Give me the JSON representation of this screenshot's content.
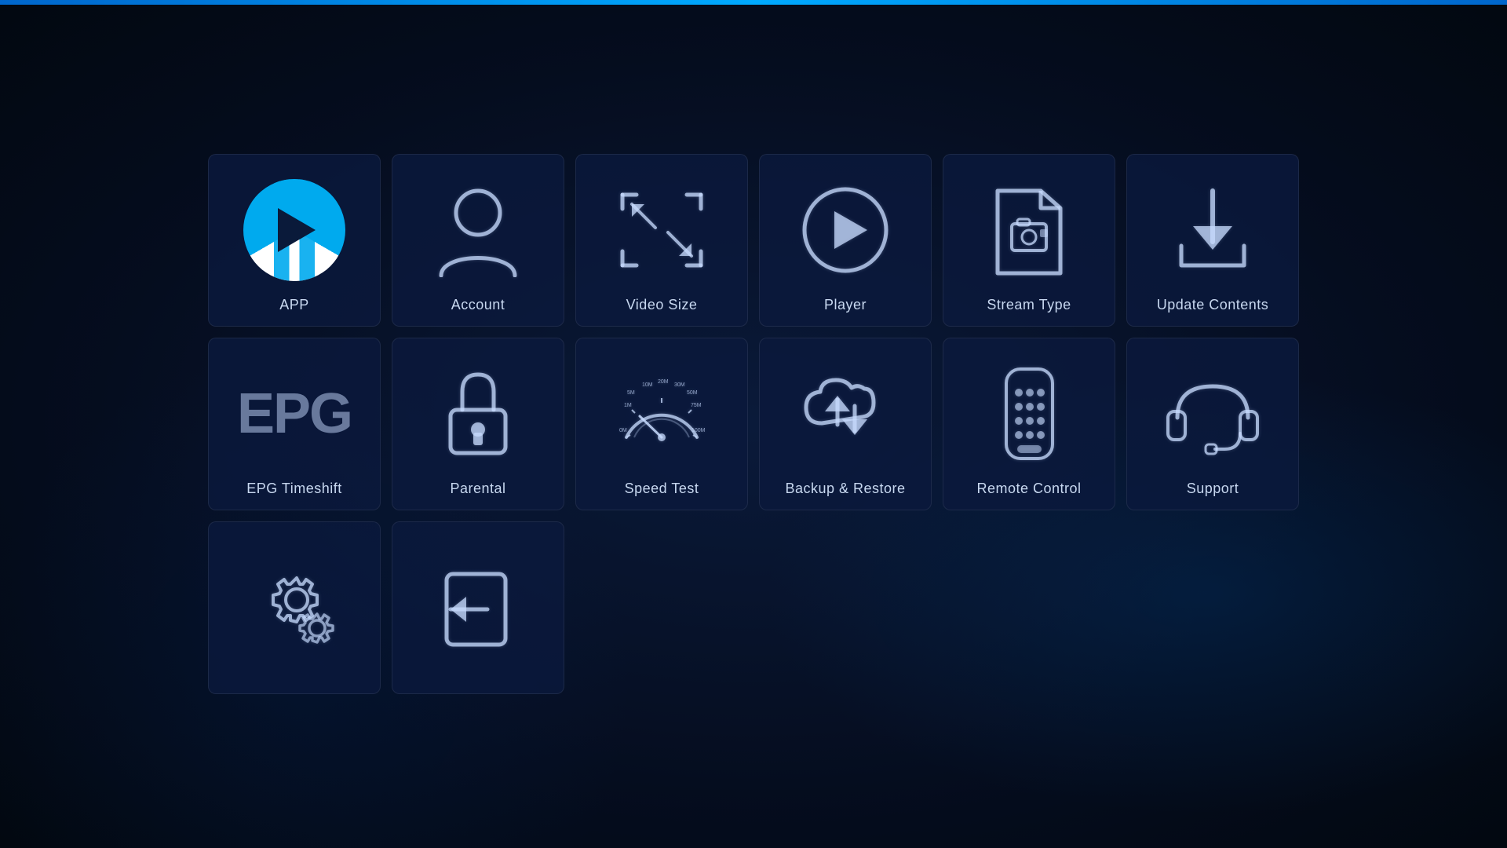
{
  "tiles": [
    {
      "id": "app",
      "label": "APP",
      "type": "app-logo"
    },
    {
      "id": "account",
      "label": "Account",
      "type": "svg-account"
    },
    {
      "id": "video-size",
      "label": "Video Size",
      "type": "svg-video-size"
    },
    {
      "id": "player",
      "label": "Player",
      "type": "svg-player"
    },
    {
      "id": "stream-type",
      "label": "Stream Type",
      "type": "svg-stream-type"
    },
    {
      "id": "update-contents",
      "label": "Update Contents",
      "type": "svg-update"
    },
    {
      "id": "epg-timeshift",
      "label": "EPG Timeshift",
      "type": "epg-text"
    },
    {
      "id": "parental",
      "label": "Parental",
      "type": "svg-parental"
    },
    {
      "id": "speed-test",
      "label": "Speed Test",
      "type": "svg-speed"
    },
    {
      "id": "backup-restore",
      "label": "Backup & Restore",
      "type": "svg-backup"
    },
    {
      "id": "remote-control",
      "label": "Remote Control",
      "type": "svg-remote"
    },
    {
      "id": "support",
      "label": "Support",
      "type": "svg-support"
    },
    {
      "id": "settings",
      "label": "",
      "type": "svg-settings"
    },
    {
      "id": "logout",
      "label": "",
      "type": "svg-logout"
    }
  ]
}
